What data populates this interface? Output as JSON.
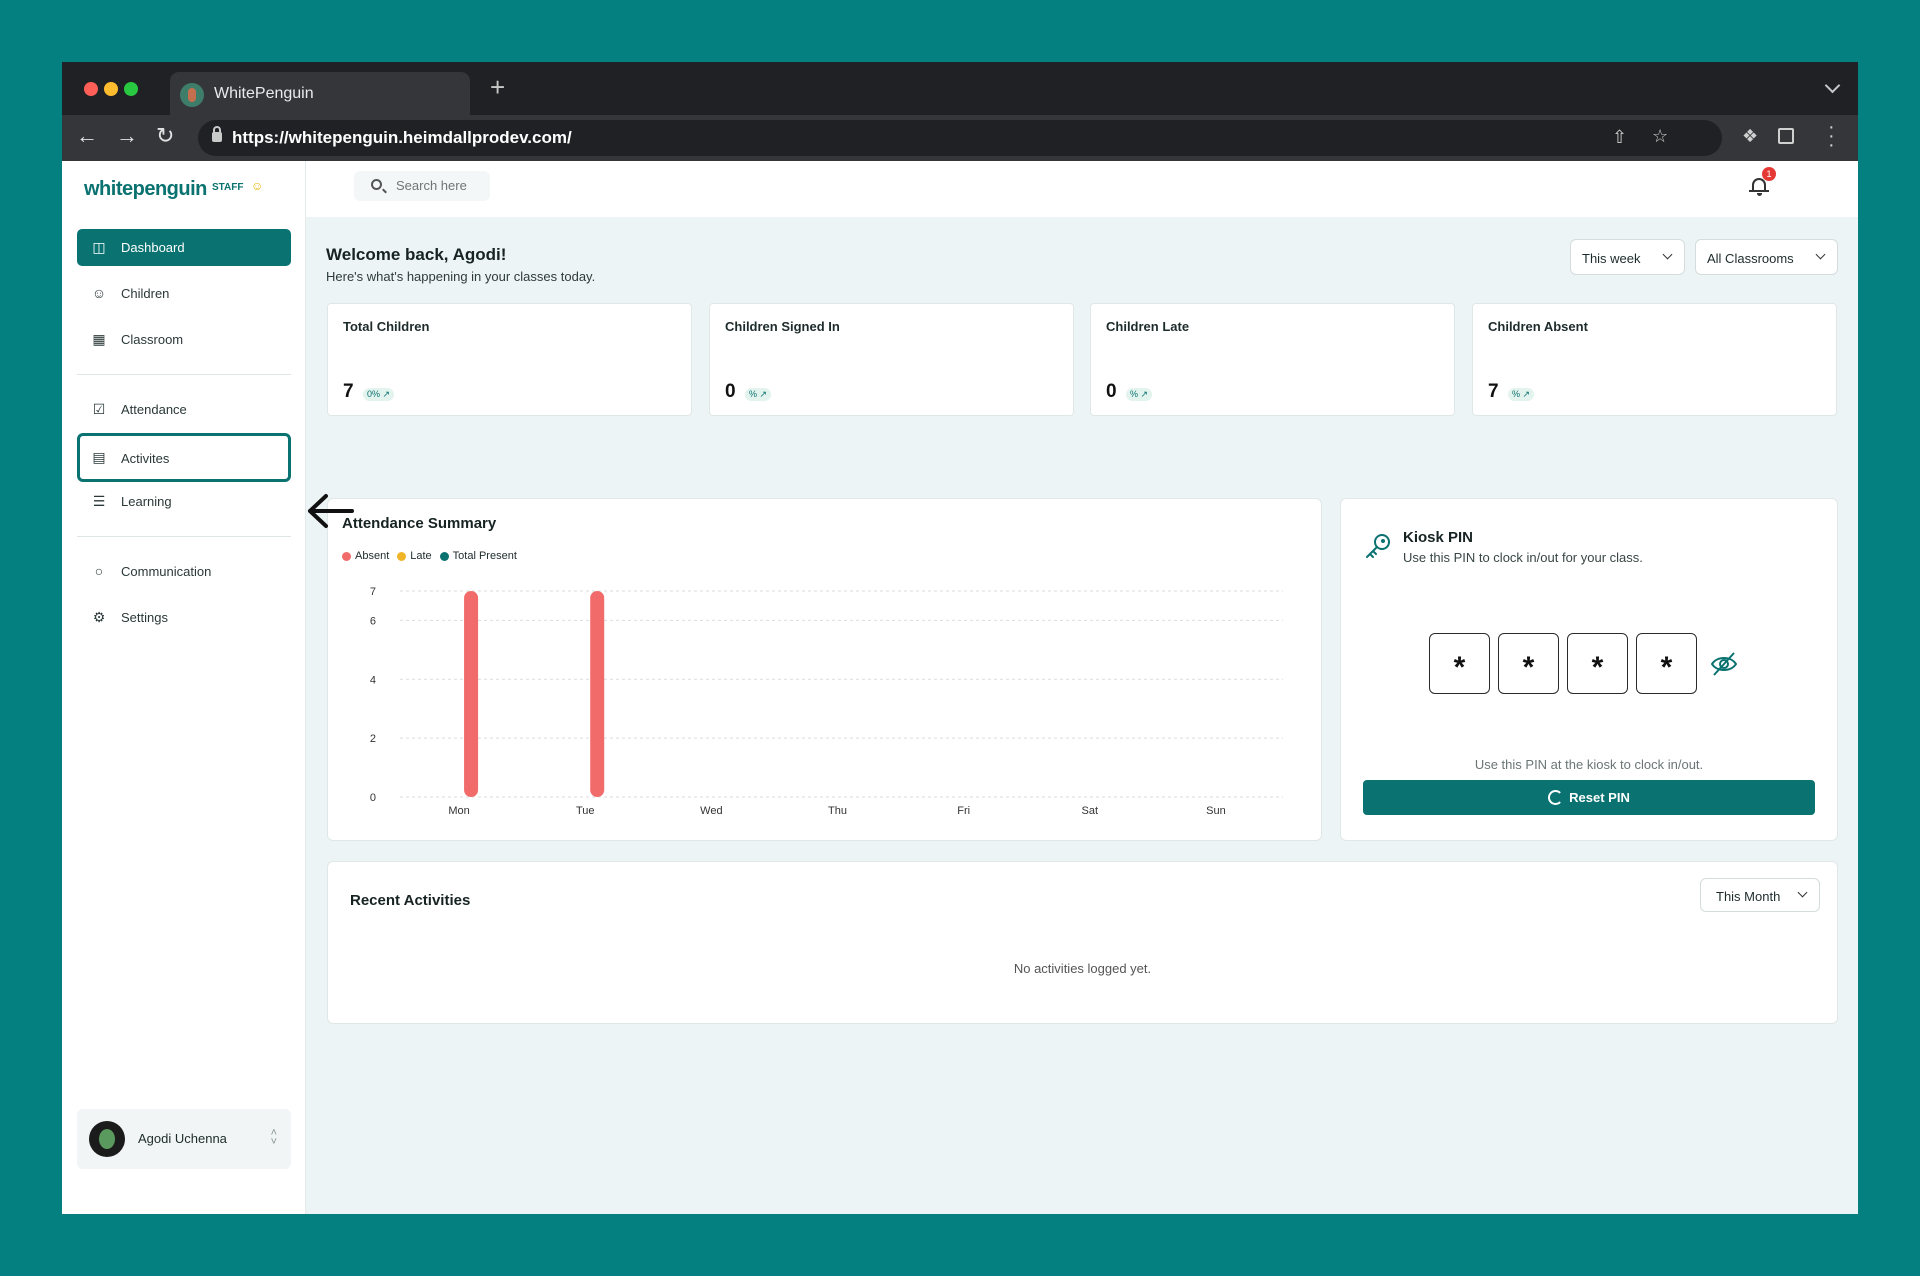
{
  "browser": {
    "tab_title": "WhitePenguin",
    "new_tab": "+",
    "url": "https://whitepenguin.heimdallprodev.com/"
  },
  "sidebar": {
    "logo": "whitepenguin",
    "badge": "STAFF",
    "items": [
      {
        "label": "Dashboard",
        "icon": "dashboard-icon"
      },
      {
        "label": "Children",
        "icon": "children-icon"
      },
      {
        "label": "Classroom",
        "icon": "grid-icon"
      },
      {
        "label": "Attendance",
        "icon": "checkbox-icon"
      },
      {
        "label": "Activites",
        "icon": "clipboard-icon"
      },
      {
        "label": "Learning",
        "icon": "book-icon"
      },
      {
        "label": "Communication",
        "icon": "chat-icon"
      },
      {
        "label": "Settings",
        "icon": "gear-icon"
      }
    ],
    "user": {
      "name": "Agodi Uchenna"
    }
  },
  "topbar": {
    "search_placeholder": "Search here",
    "notification_count": "1"
  },
  "header": {
    "welcome": "Welcome back, Agodi!",
    "subtitle": "Here's what's happening in your classes today.",
    "period_filter": "This week",
    "classroom_filter": "All Classrooms"
  },
  "stats": [
    {
      "title": "Total Children",
      "value": "7",
      "change": "0% ↗"
    },
    {
      "title": "Children Signed In",
      "value": "0",
      "change": "% ↗"
    },
    {
      "title": "Children Late",
      "value": "0",
      "change": "% ↗"
    },
    {
      "title": "Children Absent",
      "value": "7",
      "change": "% ↗"
    }
  ],
  "attendance": {
    "title": "Attendance Summary"
  },
  "chart_data": {
    "type": "bar",
    "title": "Attendance Summary",
    "categories": [
      "Mon",
      "Tue",
      "Wed",
      "Thu",
      "Fri",
      "Sat",
      "Sun"
    ],
    "series": [
      {
        "name": "Absent",
        "color": "#f26b6b",
        "values": [
          7,
          7,
          0,
          0,
          0,
          0,
          0
        ]
      },
      {
        "name": "Late",
        "color": "#f0b429",
        "values": [
          0,
          0,
          0,
          0,
          0,
          0,
          0
        ]
      },
      {
        "name": "Total Present",
        "color": "#0a7270",
        "values": [
          0,
          0,
          0,
          0,
          0,
          0,
          0
        ]
      }
    ],
    "yticks": [
      0,
      2,
      4,
      6,
      7
    ],
    "ylim": [
      0,
      7
    ],
    "grid": true,
    "legend": "top-left"
  },
  "kiosk": {
    "title": "Kiosk PIN",
    "subtitle": "Use this PIN to clock in/out for your class.",
    "digits": [
      "*",
      "*",
      "*",
      "*"
    ],
    "hint": "Use this PIN at the kiosk to clock in/out.",
    "reset_label": "Reset PIN"
  },
  "recent": {
    "title": "Recent Activities",
    "filter": "This Month",
    "empty": "No activities logged yet."
  },
  "colors": {
    "brand": "#0a7270",
    "background": "#048080",
    "absent": "#f26b6b",
    "late": "#f0b429"
  }
}
